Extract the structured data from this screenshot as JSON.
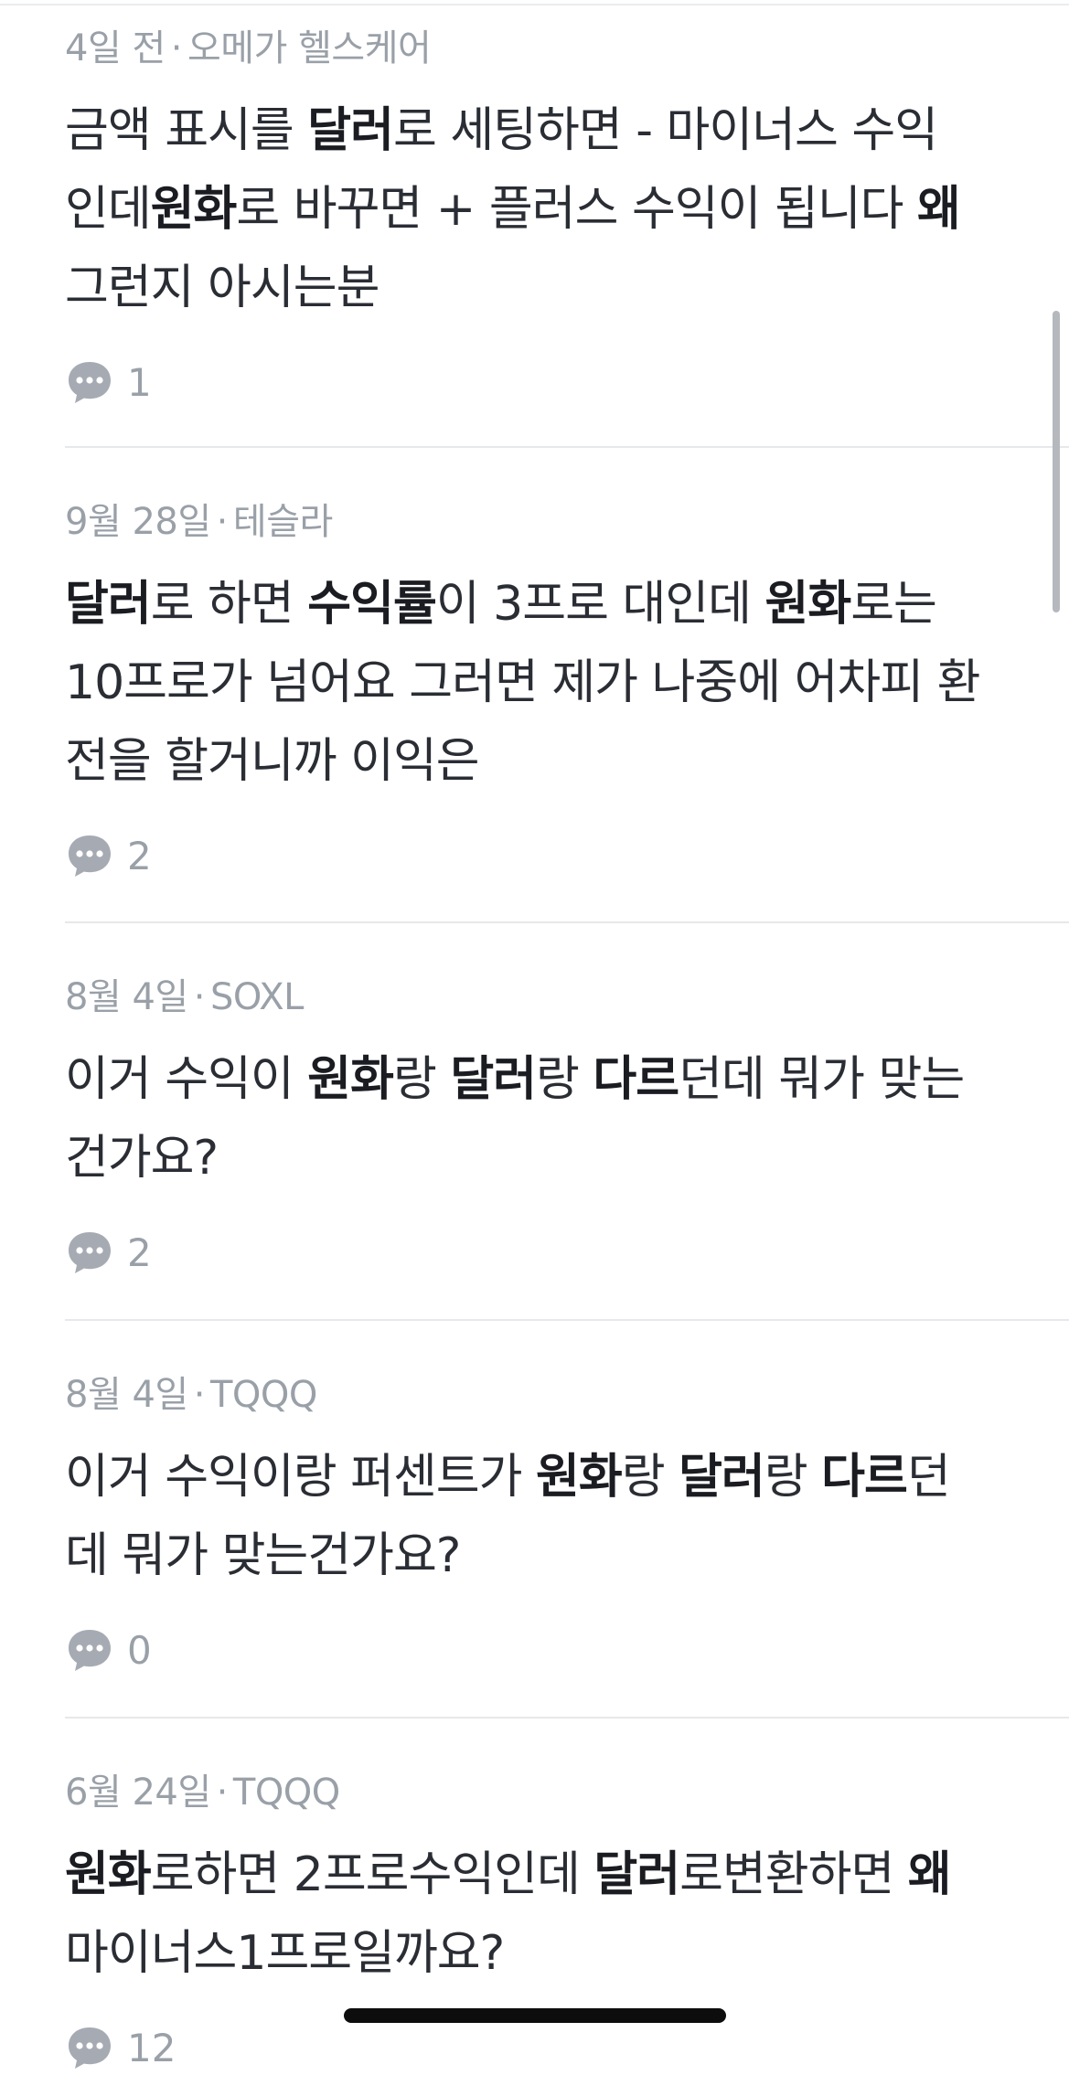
{
  "posts": [
    {
      "date": "4일 전",
      "ticker": "오메가 헬스케어",
      "title_segments": [
        {
          "text": "금액 표시를 ",
          "bold": false
        },
        {
          "text": "달러",
          "bold": true
        },
        {
          "text": "로 세팅하면 - 마이너스 수익 인데",
          "bold": false
        },
        {
          "text": "원화",
          "bold": true
        },
        {
          "text": "로 바꾸면 + 플러스 수익이 됩니다 ",
          "bold": false
        },
        {
          "text": "왜",
          "bold": true
        },
        {
          "text": " 그런지 아시는분",
          "bold": false
        }
      ],
      "comment_count": "1"
    },
    {
      "date": "9월 28일",
      "ticker": "테슬라",
      "title_segments": [
        {
          "text": "달러",
          "bold": true
        },
        {
          "text": "로 하면 ",
          "bold": false
        },
        {
          "text": "수익률",
          "bold": true
        },
        {
          "text": "이 3프로 대인데 ",
          "bold": false
        },
        {
          "text": "원화",
          "bold": true
        },
        {
          "text": "로는 10프로가 넘어요 그러면 제가 나중에 어차피 환전을 할거니까 이익은",
          "bold": false
        }
      ],
      "comment_count": "2"
    },
    {
      "date": "8월 4일",
      "ticker": "SOXL",
      "title_segments": [
        {
          "text": "이거 수익이 ",
          "bold": false
        },
        {
          "text": "원화",
          "bold": true
        },
        {
          "text": "랑 ",
          "bold": false
        },
        {
          "text": "달러",
          "bold": true
        },
        {
          "text": "랑 ",
          "bold": false
        },
        {
          "text": "다르",
          "bold": true
        },
        {
          "text": "던데 뭐가 맞는건가요?",
          "bold": false
        }
      ],
      "comment_count": "2"
    },
    {
      "date": "8월 4일",
      "ticker": "TQQQ",
      "title_segments": [
        {
          "text": "이거 수익이랑 퍼센트가 ",
          "bold": false
        },
        {
          "text": "원화",
          "bold": true
        },
        {
          "text": "랑 ",
          "bold": false
        },
        {
          "text": "달러",
          "bold": true
        },
        {
          "text": "랑 ",
          "bold": false
        },
        {
          "text": "다르",
          "bold": true
        },
        {
          "text": "던데 뭐가 맞는건가요?",
          "bold": false
        }
      ],
      "comment_count": "0"
    },
    {
      "date": "6월 24일",
      "ticker": "TQQQ",
      "title_segments": [
        {
          "text": "원화",
          "bold": true
        },
        {
          "text": "로하면 2프로수익인데 ",
          "bold": false
        },
        {
          "text": "달러",
          "bold": true
        },
        {
          "text": "로변환하면 ",
          "bold": false
        },
        {
          "text": "왜",
          "bold": true
        },
        {
          "text": "마이너스1프로일까요?",
          "bold": false
        }
      ],
      "comment_count": "12"
    }
  ],
  "meta_separator": "·",
  "icons": {
    "comment": "speech-bubble-ellipsis-icon"
  },
  "colors": {
    "meta_text": "#9aa0a8",
    "title_text": "#2a2d34",
    "divider": "#e6e8eb",
    "icon_fill": "#a6abb3"
  }
}
